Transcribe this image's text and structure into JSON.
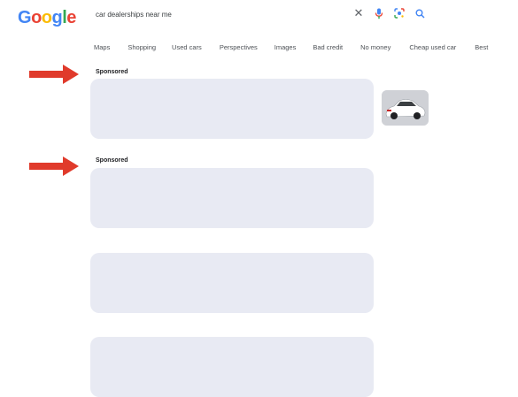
{
  "logo": {
    "letters": [
      {
        "char": "G",
        "color": "#4285F4"
      },
      {
        "char": "o",
        "color": "#EA4335"
      },
      {
        "char": "o",
        "color": "#FBBC05"
      },
      {
        "char": "g",
        "color": "#4285F4"
      },
      {
        "char": "l",
        "color": "#34A853"
      },
      {
        "char": "e",
        "color": "#EA4335"
      }
    ]
  },
  "search": {
    "query": "car dealerships near me",
    "clear_icon": "close-icon",
    "voice_icon": "microphone-icon",
    "lens_icon": "camera-lens-icon",
    "search_icon": "search-icon"
  },
  "tabs": [
    "Maps",
    "Shopping",
    "Used cars",
    "Perspectives",
    "Images",
    "Bad credit",
    "No money",
    "Cheap used car",
    "Best"
  ],
  "results": {
    "sponsored_label": "Sponsored",
    "sponsored_label_2": "Sponsored"
  },
  "colors": {
    "arrow": "#e03a2b",
    "placeholder": "#e8eaf3"
  }
}
